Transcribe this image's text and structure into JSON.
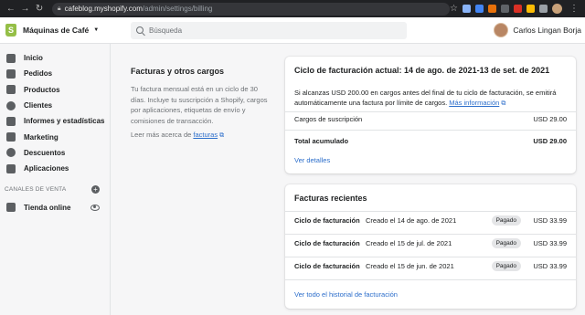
{
  "browser": {
    "url_host": "cafeblog.myshopify.com",
    "url_path": "/admin/settings/billing"
  },
  "topbar": {
    "store_name": "Máquinas de Café",
    "search_placeholder": "Búsqueda",
    "user_name": "Carlos Lingan Borja"
  },
  "sidebar": {
    "items": [
      {
        "label": "Inicio",
        "icon": "home-icon"
      },
      {
        "label": "Pedidos",
        "icon": "orders-icon"
      },
      {
        "label": "Productos",
        "icon": "tag-icon"
      },
      {
        "label": "Clientes",
        "icon": "person-icon"
      },
      {
        "label": "Informes y estadísticas",
        "icon": "chart-icon"
      },
      {
        "label": "Marketing",
        "icon": "megaphone-icon"
      },
      {
        "label": "Descuentos",
        "icon": "discount-icon"
      },
      {
        "label": "Aplicaciones",
        "icon": "apps-icon"
      }
    ],
    "channels_heading": "CANALES DE VENTA",
    "online_store": "Tienda online"
  },
  "billing": {
    "title": "Facturas y otros cargos",
    "description": "Tu factura mensual está en un ciclo de 30 días. Incluye tu suscripción a Shopify, cargos por aplicaciones, etiquetas de envío y comisiones de transacción.",
    "learn_prefix": "Leer más acerca de",
    "learn_link": "facturas"
  },
  "current_cycle": {
    "title": "Ciclo de facturación actual: 14 de ago. de 2021-13 de set. de 2021",
    "text": "Si alcanzas USD 200.00 en cargos antes del final de tu ciclo de facturación, se emitirá automáticamente una factura por límite de cargos.",
    "more_info": "Más información",
    "subscription_label": "Cargos de suscripción",
    "subscription_amount": "USD 29.00",
    "total_label": "Total acumulado",
    "total_amount": "USD 29.00",
    "details_link": "Ver detalles"
  },
  "recent": {
    "title": "Facturas recientes",
    "invoices": [
      {
        "label": "Ciclo de facturación",
        "date": "Creado el 14 de ago. de 2021",
        "status": "Pagado",
        "amount": "USD 33.99"
      },
      {
        "label": "Ciclo de facturación",
        "date": "Creado el 15 de jul. de 2021",
        "status": "Pagado",
        "amount": "USD 33.99"
      },
      {
        "label": "Ciclo de facturación",
        "date": "Creado el 15 de jun. de 2021",
        "status": "Pagado",
        "amount": "USD 33.99"
      }
    ],
    "history_link": "Ver todo el historial de facturación"
  },
  "colors": {
    "link": "#2c6ecb",
    "shopify_green": "#95bf47",
    "badge_bg": "#e4e5e7"
  }
}
